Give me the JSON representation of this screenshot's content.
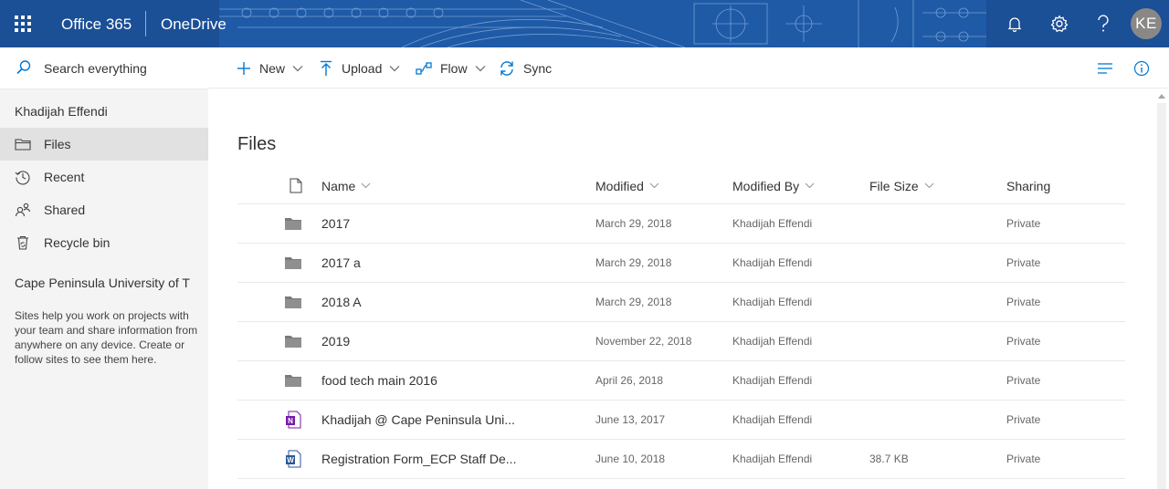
{
  "suitebar": {
    "brand": "Office 365",
    "app_name": "OneDrive",
    "avatar_initials": "KE",
    "bg_color": "#1b4f96"
  },
  "leftnav": {
    "search_placeholder": "Search everything",
    "user_name": "Khadijah Effendi",
    "items": [
      {
        "label": "Files",
        "icon": "folder-icon",
        "selected": true
      },
      {
        "label": "Recent",
        "icon": "clock-icon",
        "selected": false
      },
      {
        "label": "Shared",
        "icon": "people-icon",
        "selected": false
      },
      {
        "label": "Recycle bin",
        "icon": "recycle-bin-icon",
        "selected": false
      }
    ],
    "sites_title": "Cape Peninsula University of T",
    "sites_desc": "Sites help you work on projects with your team and share information from anywhere on any device. Create or follow sites to see them here."
  },
  "commandbar": {
    "new_label": "New",
    "upload_label": "Upload",
    "flow_label": "Flow",
    "sync_label": "Sync"
  },
  "main": {
    "title": "Files",
    "columns": {
      "name": "Name",
      "modified": "Modified",
      "modified_by": "Modified By",
      "file_size": "File Size",
      "sharing": "Sharing"
    },
    "rows": [
      {
        "type": "folder",
        "name": "2017",
        "modified": "March 29, 2018",
        "modified_by": "Khadijah Effendi",
        "size": "",
        "sharing": "Private"
      },
      {
        "type": "folder",
        "name": "2017 a",
        "modified": "March 29, 2018",
        "modified_by": "Khadijah Effendi",
        "size": "",
        "sharing": "Private"
      },
      {
        "type": "folder",
        "name": "2018 A",
        "modified": "March 29, 2018",
        "modified_by": "Khadijah Effendi",
        "size": "",
        "sharing": "Private"
      },
      {
        "type": "folder",
        "name": "2019",
        "modified": "November 22, 2018",
        "modified_by": "Khadijah Effendi",
        "size": "",
        "sharing": "Private"
      },
      {
        "type": "folder",
        "name": "food tech main 2016",
        "modified": "April 26, 2018",
        "modified_by": "Khadijah Effendi",
        "size": "",
        "sharing": "Private"
      },
      {
        "type": "onenote",
        "name": "Khadijah @ Cape Peninsula Uni...",
        "modified": "June 13, 2017",
        "modified_by": "Khadijah Effendi",
        "size": "",
        "sharing": "Private"
      },
      {
        "type": "word",
        "name": "Registration Form_ECP Staff De...",
        "modified": "June 10, 2018",
        "modified_by": "Khadijah Effendi",
        "size": "38.7 KB",
        "sharing": "Private"
      }
    ]
  }
}
